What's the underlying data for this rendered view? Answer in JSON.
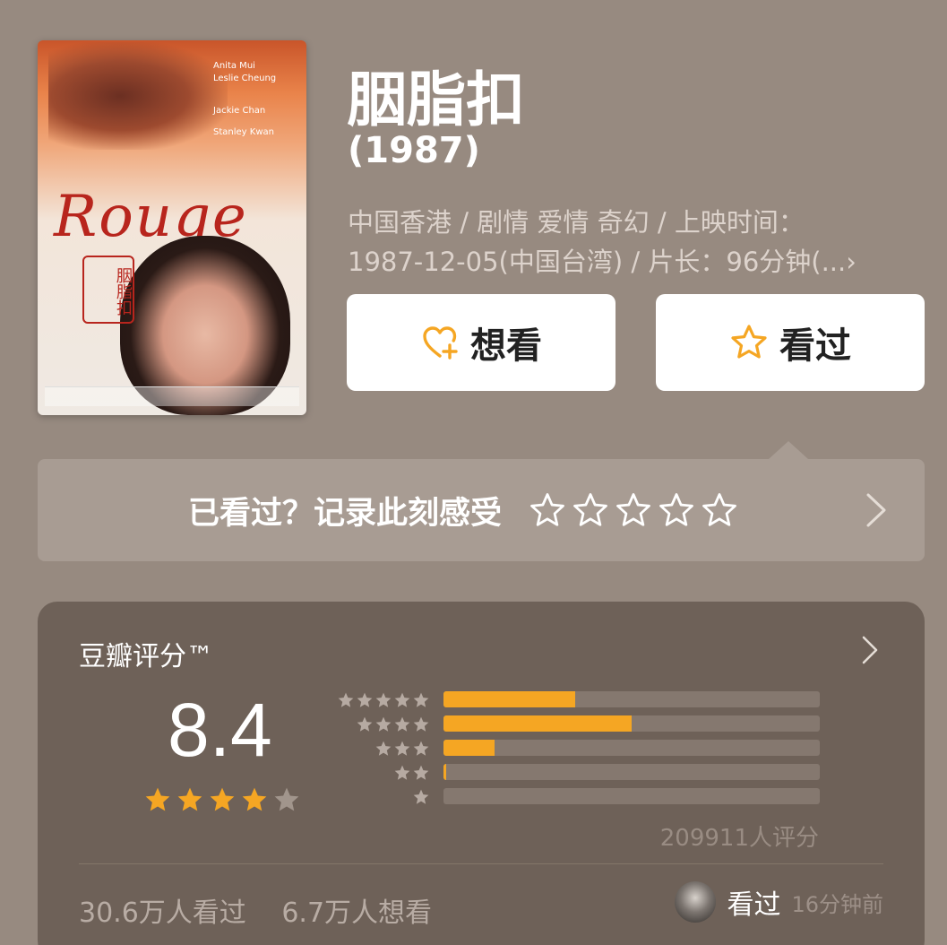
{
  "movie": {
    "title": "胭脂扣",
    "year": "(1987)",
    "meta_line1": "中国香港 / 剧情 爱情 奇幻 / 上映时间：",
    "meta_line2": "1987-12-05(中国台湾) / 片长：96分钟(...›",
    "poster": {
      "wordmark": "Rouge",
      "seal": "胭脂扣",
      "credits": [
        "Anita Mui",
        "Leslie Cheung",
        "Jackie Chan",
        "Stanley Kwan"
      ]
    }
  },
  "actions": {
    "want_label": "想看",
    "seen_label": "看过"
  },
  "record": {
    "prompt": "已看过？记录此刻感受",
    "star_count": 5
  },
  "rating": {
    "label": "豆瓣评分™",
    "score": "8.4",
    "stars": 4,
    "max_stars": 5,
    "distribution": [
      {
        "stars": 5,
        "fraction": 0.35
      },
      {
        "stars": 4,
        "fraction": 0.5
      },
      {
        "stars": 3,
        "fraction": 0.135
      },
      {
        "stars": 2,
        "fraction": 0.007
      },
      {
        "stars": 1,
        "fraction": 0.0
      }
    ],
    "count": "209911人评分",
    "watched": "30.6万人看过",
    "wanted": "6.7万人想看",
    "friend_action": "看过",
    "friend_time": "16分钟前"
  },
  "colors": {
    "background": "#978a80",
    "accent": "#f5a623",
    "card": "#6e6158"
  }
}
